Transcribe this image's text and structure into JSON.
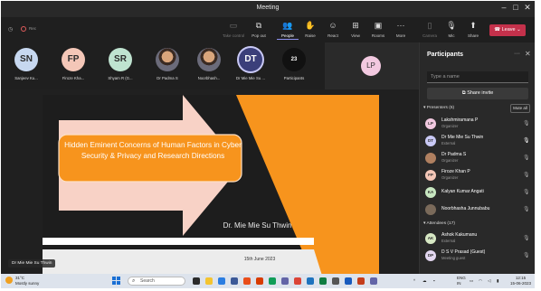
{
  "window": {
    "title": "Meeting"
  },
  "toolbar": {
    "recording_label": "Rec",
    "buttons": [
      {
        "label": "Take control",
        "icon": "cast-icon"
      },
      {
        "label": "Pop out",
        "icon": "popout-icon"
      },
      {
        "label": "People",
        "icon": "people-icon"
      },
      {
        "label": "Raise",
        "icon": "hand-icon"
      },
      {
        "label": "React",
        "icon": "smile-icon"
      },
      {
        "label": "View",
        "icon": "grid-icon"
      },
      {
        "label": "Rooms",
        "icon": "rooms-icon"
      },
      {
        "label": "More",
        "icon": "more-icon"
      },
      {
        "label": "Camera",
        "icon": "camera-icon"
      },
      {
        "label": "Mic",
        "icon": "mic-icon"
      },
      {
        "label": "Share",
        "icon": "share-icon"
      }
    ],
    "leave_label": "Leave"
  },
  "strip": {
    "attendees": [
      {
        "initials": "SN",
        "name": "Sanjeev Ku...",
        "color": "#c7d8f0"
      },
      {
        "initials": "FP",
        "name": "Firoze Kha...",
        "color": "#f4c7b8"
      },
      {
        "initials": "SR",
        "name": "Shyam R (G...",
        "color": "#bfe3d0"
      },
      {
        "initials": "",
        "name": "Dr Padma S",
        "color": "#888"
      },
      {
        "initials": "",
        "name": "Noorbhash...",
        "color": "#888"
      },
      {
        "initials": "DT",
        "name": "Dr Mie Mie Su ...",
        "color": "#3b3f7a"
      }
    ],
    "participants_count": "23",
    "participants_label": "Participants",
    "tile_initials": "LP"
  },
  "slide": {
    "title": "Hidden Eminent Concerns of Human Factors in Cyber Security & Privacy and Research Directions",
    "author": "Dr. Mie Mie Su Thwin",
    "date": "15th June 2023",
    "presenter_tag": "Dr Mie Mie Su Thwin"
  },
  "panel": {
    "title": "Participants",
    "search_placeholder": "Type a name",
    "share_invite": "Share invite",
    "presenters_header": "Presenters (6)",
    "mute_all": "Mute all",
    "presenters": [
      {
        "initials": "LP",
        "name": "Lakshmiramana P",
        "role": "Organizer",
        "color": "#f2c9e0"
      },
      {
        "initials": "DT",
        "name": "Dr Mie Mie Su Thwin",
        "role": "External",
        "color": "#c9c9f5"
      },
      {
        "initials": "",
        "name": "Dr Padma S",
        "role": "Organizer",
        "color": "#b08060"
      },
      {
        "initials": "FP",
        "name": "Firoze Khan P",
        "role": "Organizer",
        "color": "#f4c7b8"
      },
      {
        "initials": "KA",
        "name": "Kalyan Kumar Angati",
        "role": "",
        "color": "#c7e6c0"
      },
      {
        "initials": "",
        "name": "Noorbhasha Junnubabu",
        "role": "",
        "color": "#7a6a5a"
      }
    ],
    "attendees_header": "Attendees (17)",
    "attendees": [
      {
        "initials": "AK",
        "name": "Ashok Kakumanu",
        "role": "External",
        "color": "#d7e8c4"
      },
      {
        "initials": "DP",
        "name": "D S V Prasad (Guest)",
        "role": "Meeting guest",
        "color": "#e3d7f0"
      }
    ]
  },
  "taskbar": {
    "temperature": "31°C",
    "weather": "Mostly sunny",
    "search_placeholder": "Search",
    "lang": "ENG",
    "region": "IN",
    "time": "12:15",
    "date": "15-06-2023"
  },
  "colors": {
    "accent": "#f7941d",
    "leave": "#c4314b",
    "teams_purple": "#8e93f0"
  }
}
